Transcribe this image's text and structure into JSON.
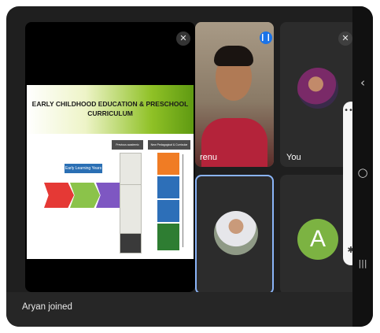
{
  "meeting": {
    "presentation": {
      "title_line1": "EARLY CHILDHOOD EDUCATION & PRESCHOOL",
      "title_line2": "CURRICULUM",
      "left_heading": "Early Learning Years",
      "chevrons": [
        "",
        "",
        ""
      ],
      "right_headers": [
        "Previous academic structure",
        "New Pedagogical & Curricular Structure"
      ],
      "stairs": [
        "",
        "",
        ""
      ],
      "groups": [
        "",
        "",
        "",
        ""
      ]
    },
    "participants": [
      {
        "name": "renu",
        "status": "speaking"
      },
      {
        "name": "You",
        "status": "muted"
      },
      {
        "name": "",
        "status": "muted"
      },
      {
        "name": "",
        "initial": "A",
        "avatar_color": "#7cb342",
        "status": "muted"
      }
    ],
    "side_panel": {
      "more_label": "•••"
    },
    "toast": "Aryan joined",
    "nav": {
      "back": "‹",
      "home": "○",
      "recents": "|||"
    }
  }
}
